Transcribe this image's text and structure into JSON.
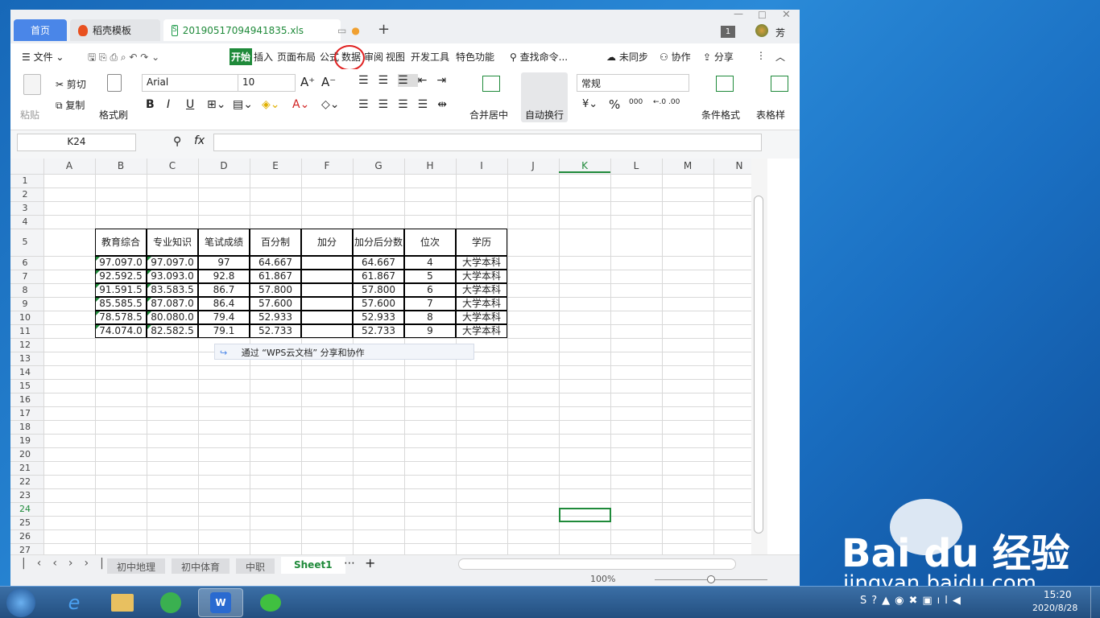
{
  "tabs": {
    "home": "首页",
    "templates": "稻壳模板",
    "file": "20190517094941835.xls",
    "badge": "1",
    "user": "芳"
  },
  "menu": {
    "file": "文件",
    "items": [
      "开始",
      "插入",
      "页面布局",
      "公式",
      "数据",
      "审阅",
      "视图",
      "开发工具",
      "特色功能"
    ],
    "search": "查找命令...",
    "sync": "未同步",
    "collab": "协作",
    "share": "分享"
  },
  "ribbon": {
    "paste": "粘贴",
    "cut": "剪切",
    "copy": "复制",
    "format_painter": "格式刷",
    "font": "Arial",
    "size": "10",
    "merge": "合并居中",
    "wrap": "自动换行",
    "number_format": "常规",
    "percent": "%",
    "thousands": "000",
    "cond_format": "条件格式",
    "table_style": "表格样"
  },
  "formula": {
    "name_box": "K24",
    "fx": "fx",
    "value": ""
  },
  "columns": [
    "A",
    "B",
    "C",
    "D",
    "E",
    "F",
    "G",
    "H",
    "I",
    "J",
    "K",
    "L",
    "M",
    "N"
  ],
  "rows": [
    "1",
    "2",
    "3",
    "4",
    "5",
    "6",
    "7",
    "8",
    "9",
    "10",
    "11",
    "12",
    "13",
    "14",
    "15",
    "16",
    "17",
    "18",
    "19",
    "20",
    "21",
    "22",
    "23",
    "24",
    "25",
    "26",
    "27"
  ],
  "table": {
    "headers": [
      "教育综合",
      "专业知识",
      "笔试成绩",
      "百分制",
      "加分",
      "加分后分数",
      "位次",
      "学历"
    ],
    "rows": [
      [
        "97.0",
        "97.0",
        "97",
        "64.667",
        "",
        "64.667",
        "4",
        "大学本科"
      ],
      [
        "92.5",
        "93.0",
        "92.8",
        "61.867",
        "",
        "61.867",
        "5",
        "大学本科"
      ],
      [
        "91.5",
        "83.5",
        "86.7",
        "57.800",
        "",
        "57.800",
        "6",
        "大学本科"
      ],
      [
        "85.5",
        "87.0",
        "86.4",
        "57.600",
        "",
        "57.600",
        "7",
        "大学本科"
      ],
      [
        "78.5",
        "80.0",
        "79.4",
        "52.933",
        "",
        "52.933",
        "8",
        "大学本科"
      ],
      [
        "74.0",
        "82.5",
        "79.1",
        "52.733",
        "",
        "52.733",
        "9",
        "大学本科"
      ]
    ]
  },
  "popup": "通过 “WPS云文档” 分享和协作",
  "sheets": [
    "初中地理",
    "初中体育",
    "中职",
    "Sheet1"
  ],
  "status": {
    "zoom": "100%"
  },
  "clock": {
    "time": "15:20",
    "date": "2020/8/28"
  },
  "watermark": {
    "brand": "Bai du 经验",
    "url": "jingyan.baidu.com"
  },
  "colors": {
    "accent": "#1f8a3a",
    "tab_blue": "#4a86e8",
    "annotation": "#e02020"
  }
}
